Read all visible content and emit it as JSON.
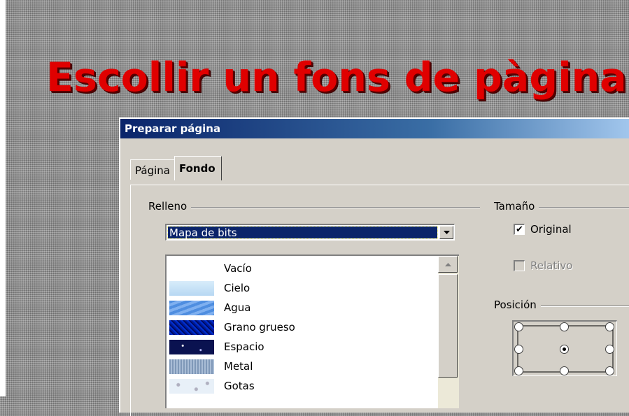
{
  "slide": {
    "title": "Escollir un fons de pàgina"
  },
  "dialog": {
    "title": "Preparar página",
    "tabs": [
      {
        "label": "Página",
        "active": false
      },
      {
        "label": "Fondo",
        "active": true
      }
    ],
    "fill_group": {
      "label": "Relleno",
      "selected_type": "Mapa de bits",
      "bitmaps": [
        {
          "name": "Vacío",
          "swatch": "empty"
        },
        {
          "name": "Cielo",
          "swatch": "sky"
        },
        {
          "name": "Agua",
          "swatch": "water"
        },
        {
          "name": "Grano grueso",
          "swatch": "coarse-grain"
        },
        {
          "name": "Espacio",
          "swatch": "space"
        },
        {
          "name": "Metal",
          "swatch": "metal"
        },
        {
          "name": "Gotas",
          "swatch": "drops"
        }
      ]
    },
    "size_group": {
      "label": "Tamaño",
      "original": {
        "label": "Original",
        "checked": true,
        "enabled": true
      },
      "relative": {
        "label": "Relativo",
        "checked": false,
        "enabled": false
      }
    },
    "position_group": {
      "label": "Posición",
      "selected": "center"
    }
  },
  "colors": {
    "title_red": "#e00000",
    "dialog_bg": "#d4d0c8",
    "titlebar_start": "#0a246a",
    "selection": "#0a246a"
  }
}
